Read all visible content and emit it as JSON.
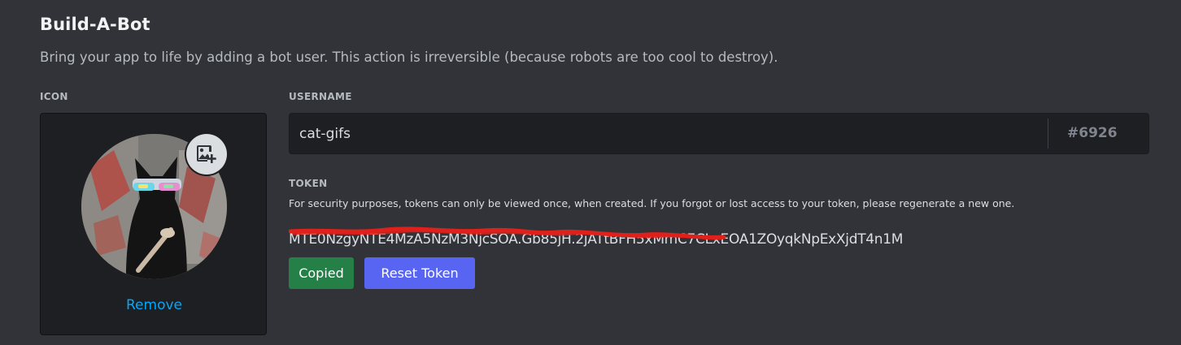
{
  "page": {
    "title": "Build-A-Bot",
    "subtitle": "Bring your app to life by adding a bot user. This action is irreversible (because robots are too cool to destroy)."
  },
  "icon_section": {
    "label": "ICON",
    "avatar_icon": "cat-avatar-image",
    "upload_icon": "image-plus-icon",
    "remove_label": "Remove"
  },
  "username_section": {
    "label": "USERNAME",
    "value": "cat-gifs",
    "discriminator": "#6926"
  },
  "token_section": {
    "label": "TOKEN",
    "description": "For security purposes, tokens can only be viewed once, when created. If you forgot or lost access to your token, please regenerate a new one.",
    "value": "MTE0NzgyNTE4MzA5NzM3NjcSOA.Gb85jH.2jATtBFH5xMmC7CLxEOA1ZOyqkNpExXjdT4n1M",
    "copied_label": "Copied",
    "reset_label": "Reset Token"
  },
  "colors": {
    "background": "#313338",
    "input_background": "#1e1f22",
    "link": "#00a8fc",
    "success": "#248046",
    "brand": "#5865f2",
    "redaction": "#e0201b"
  }
}
